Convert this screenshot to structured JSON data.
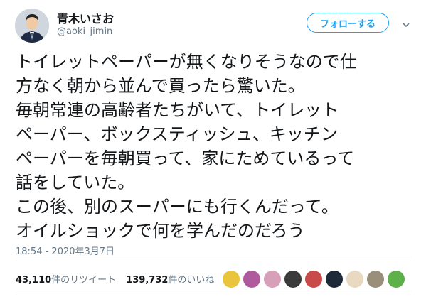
{
  "user": {
    "display_name": "青木いさお",
    "handle": "@aoki_jimin"
  },
  "follow_button": {
    "label": "フォローする"
  },
  "tweet": {
    "text": "トイレットペーパーが無くなりそうなので仕\n方なく朝から並んで買ったら驚いた。\n毎朝常連の高齢者たちがいて、トイレット\nペーパー、ボックスティッシュ、キッチン\nペーパーを毎朝買って、家にためているって\n話をしていた。\nこの後、別のスーパーにも行くんだって。\nオイルショックで何を学んだのだろう",
    "timestamp": "18:54 - 2020年3月7日"
  },
  "stats": {
    "retweets": "43,110",
    "retweets_label": "件のリツイート",
    "likes": "139,732",
    "likes_label": "件のいいね"
  },
  "liker_avatars": [
    {
      "color": "#e8c53a",
      "name": "liker-avatar-1"
    },
    {
      "color": "#b05a9e",
      "name": "liker-avatar-2"
    },
    {
      "color": "#d8a0b8",
      "name": "liker-avatar-3"
    },
    {
      "color": "#3b3b3b",
      "name": "liker-avatar-4"
    },
    {
      "color": "#c94a4a",
      "name": "liker-avatar-5"
    },
    {
      "color": "#1e2a3a",
      "name": "liker-avatar-6"
    },
    {
      "color": "#e8d9c0",
      "name": "liker-avatar-7"
    },
    {
      "color": "#9a8f7a",
      "name": "liker-avatar-8"
    },
    {
      "color": "#5db04a",
      "name": "liker-avatar-9"
    }
  ],
  "colors": {
    "accent": "#1da1f2",
    "text": "#14171a",
    "secondary": "#657786"
  }
}
